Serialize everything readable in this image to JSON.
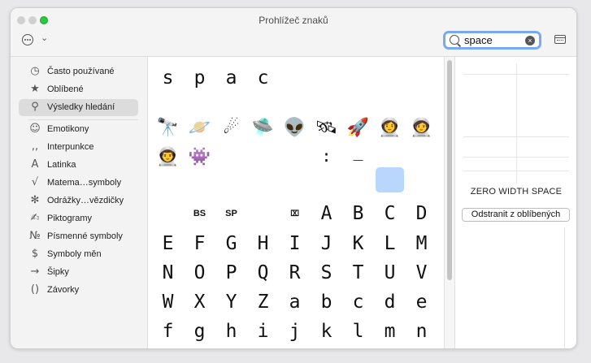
{
  "window": {
    "title": "Prohlížeč znaků"
  },
  "search": {
    "value": "space",
    "clear_glyph": "×"
  },
  "toolbar": {
    "actions_chevron": "⌄"
  },
  "sidebar": {
    "items": [
      {
        "icon": "clock-icon",
        "glyph": "◷",
        "label": "Často používané"
      },
      {
        "icon": "star-icon",
        "glyph": "★",
        "label": "Oblíbené"
      },
      {
        "icon": "search-icon",
        "glyph": "⚲",
        "label": "Výsledky hledání",
        "selected": true
      },
      {
        "icon": "smiley-icon",
        "glyph": "☺",
        "label": "Emotikony"
      },
      {
        "icon": "punctuation-icon",
        "glyph": ",,",
        "label": "Interpunkce"
      },
      {
        "icon": "latin-icon",
        "glyph": "A",
        "label": "Latinka"
      },
      {
        "icon": "math-icon",
        "glyph": "√",
        "label": "Matema…symboly"
      },
      {
        "icon": "asterisk-icon",
        "glyph": "✻",
        "label": "Odrážky…vězdičky"
      },
      {
        "icon": "pictogram-icon",
        "glyph": "✍",
        "label": "Piktogramy"
      },
      {
        "icon": "numero-icon",
        "glyph": "№",
        "label": "Písmenné symboly"
      },
      {
        "icon": "currency-icon",
        "glyph": "$",
        "label": "Symboly měn"
      },
      {
        "icon": "arrow-icon",
        "glyph": "→",
        "label": "Šipky"
      },
      {
        "icon": "parentheses-icon",
        "glyph": "()",
        "label": "Závorky"
      }
    ]
  },
  "grid": {
    "row1": [
      "s",
      "p",
      "a",
      "c"
    ],
    "emoji1": [
      "🔭",
      "🪐",
      "☄",
      "🛸",
      "👽",
      "🛰",
      "🚀",
      "👩‍🚀",
      "🧑‍🚀"
    ],
    "emoji2": [
      "👨‍🚀",
      "👾",
      "",
      "",
      "",
      ":",
      "_"
    ],
    "ctrl": [
      "BS",
      "SP",
      "",
      "⌧",
      "A",
      "B",
      "C",
      "D"
    ],
    "rowE": [
      "E",
      "F",
      "G",
      "H",
      "I",
      "J",
      "K",
      "L",
      "M"
    ],
    "rowN": [
      "N",
      "O",
      "P",
      "Q",
      "R",
      "S",
      "T",
      "U",
      "V"
    ],
    "rowW": [
      "W",
      "X",
      "Y",
      "Z",
      "a",
      "b",
      "c",
      "d",
      "e"
    ],
    "rowF": [
      "f",
      "g",
      "h",
      "i",
      "j",
      "k",
      "l",
      "m",
      "n"
    ]
  },
  "detail": {
    "char_name": "ZERO WIDTH SPACE",
    "favorite_button": "Odstranit z oblíbených"
  }
}
